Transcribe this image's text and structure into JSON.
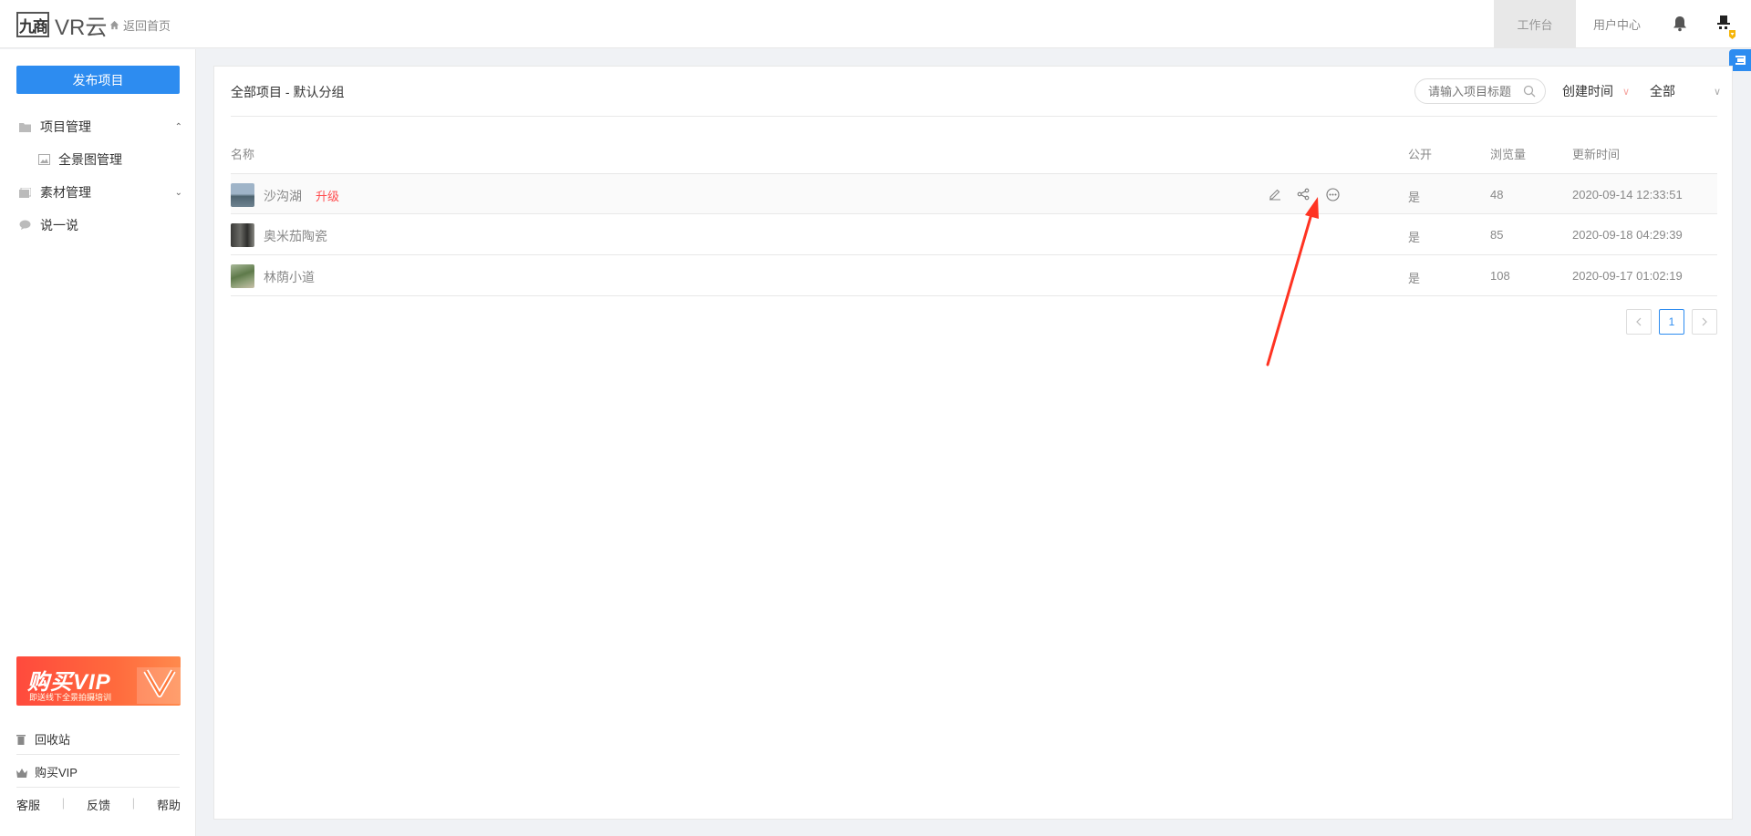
{
  "header": {
    "logo_mark": "九商",
    "logo_text": "VR云",
    "back_home": "返回首页",
    "tabs": [
      {
        "label": "工作台",
        "active": true
      },
      {
        "label": "用户中心",
        "active": false
      }
    ]
  },
  "sidebar": {
    "publish_button": "发布项目",
    "items": [
      {
        "label": "项目管理",
        "icon": "folder-icon",
        "caret": "^"
      },
      {
        "label": "全景图管理",
        "icon": "image-icon"
      },
      {
        "label": "素材管理",
        "icon": "stack-icon",
        "caret": "v"
      },
      {
        "label": "说一说",
        "icon": "chat-icon"
      }
    ],
    "vip_banner": {
      "title": "购买VIP",
      "subtitle": "即送线下全景拍摄培训"
    },
    "bottom": {
      "recycle": "回收站",
      "buy_vip": "购买VIP"
    },
    "footer_links": [
      "客服",
      "反馈",
      "帮助"
    ]
  },
  "main": {
    "breadcrumb": "全部项目 - 默认分组",
    "search_placeholder": "请输入项目标题",
    "sort_label": "创建时间",
    "filter_label": "全部",
    "columns": {
      "name": "名称",
      "public": "公开",
      "views": "浏览量",
      "updated": "更新时间"
    },
    "rows": [
      {
        "title": "沙沟湖",
        "upgrade": "升级",
        "public": "是",
        "views": "48",
        "updated": "2020-09-14 12:33:51",
        "thumb_color": "#6f88a4"
      },
      {
        "title": "奥米茄陶瓷",
        "upgrade": "",
        "public": "是",
        "views": "85",
        "updated": "2020-09-18 04:29:39",
        "thumb_color": "#4a4a48"
      },
      {
        "title": "林荫小道",
        "upgrade": "",
        "public": "是",
        "views": "108",
        "updated": "2020-09-17 01:02:19",
        "thumb_color": "#7c9468"
      }
    ],
    "pagination": {
      "current": "1",
      "prev_icon": "chevron-left-icon",
      "next_icon": "chevron-right-icon"
    }
  },
  "colors": {
    "primary": "#2d8cf0",
    "danger": "#ff4d4f",
    "annotation": "#ff3322"
  }
}
